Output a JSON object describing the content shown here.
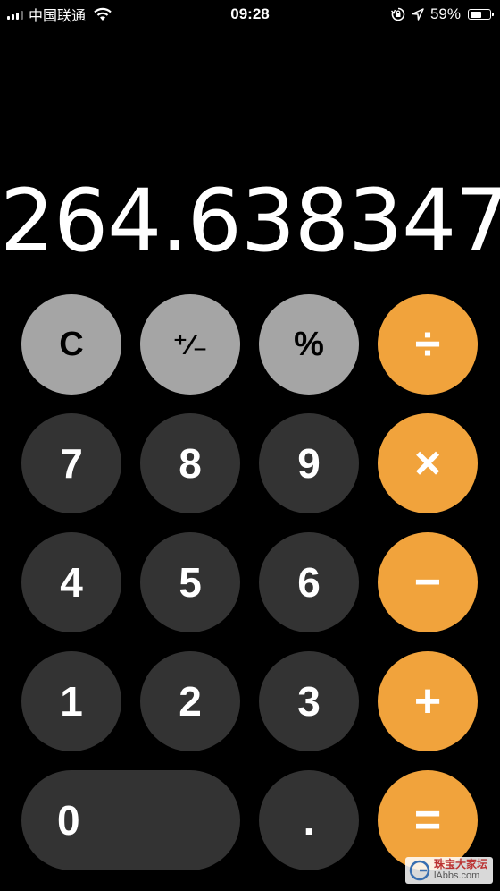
{
  "status_bar": {
    "carrier": "中国联通",
    "time": "09:28",
    "battery_percent": "59%",
    "battery_level": 0.59,
    "icons": [
      "signal-icon",
      "wifi-icon",
      "orientation-lock-icon",
      "location-arrow-icon",
      "battery-icon"
    ]
  },
  "display": {
    "value": "264.638347"
  },
  "keys": {
    "clear": "C",
    "plus_minus": "⁺∕₋",
    "percent": "%",
    "divide": "÷",
    "seven": "7",
    "eight": "8",
    "nine": "9",
    "multiply": "×",
    "four": "4",
    "five": "5",
    "six": "6",
    "minus": "−",
    "one": "1",
    "two": "2",
    "three": "3",
    "plus": "+",
    "zero": "0",
    "decimal": ".",
    "equals": "="
  },
  "colors": {
    "background": "#000000",
    "function_key": "#a5a5a5",
    "number_key": "#333333",
    "operator_key": "#f1a33c"
  },
  "watermark": {
    "name": "珠宝大家坛",
    "url": "lAbbs.com"
  }
}
